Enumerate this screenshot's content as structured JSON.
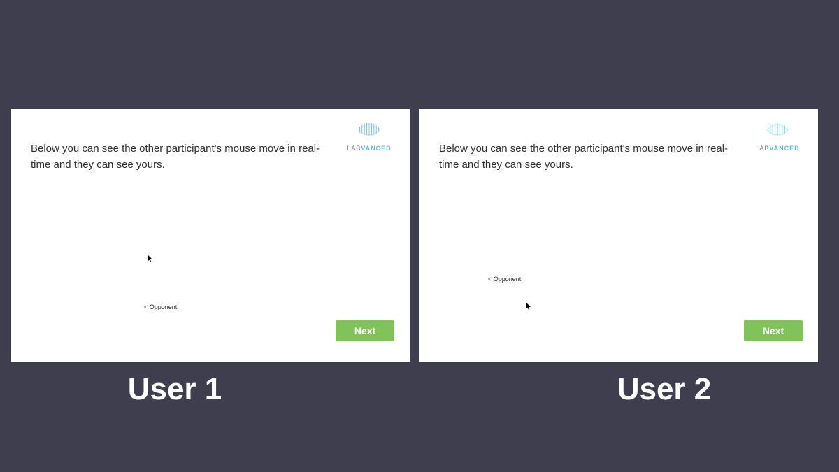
{
  "instruction_text": "Below you can see the other participant's mouse move in real-time and they can see yours.",
  "brand_a": "LAB",
  "brand_b": "VANCED",
  "opponent_label": "< Opponent",
  "next_label": "Next",
  "users": {
    "left": "User 1",
    "right": "User 2"
  }
}
